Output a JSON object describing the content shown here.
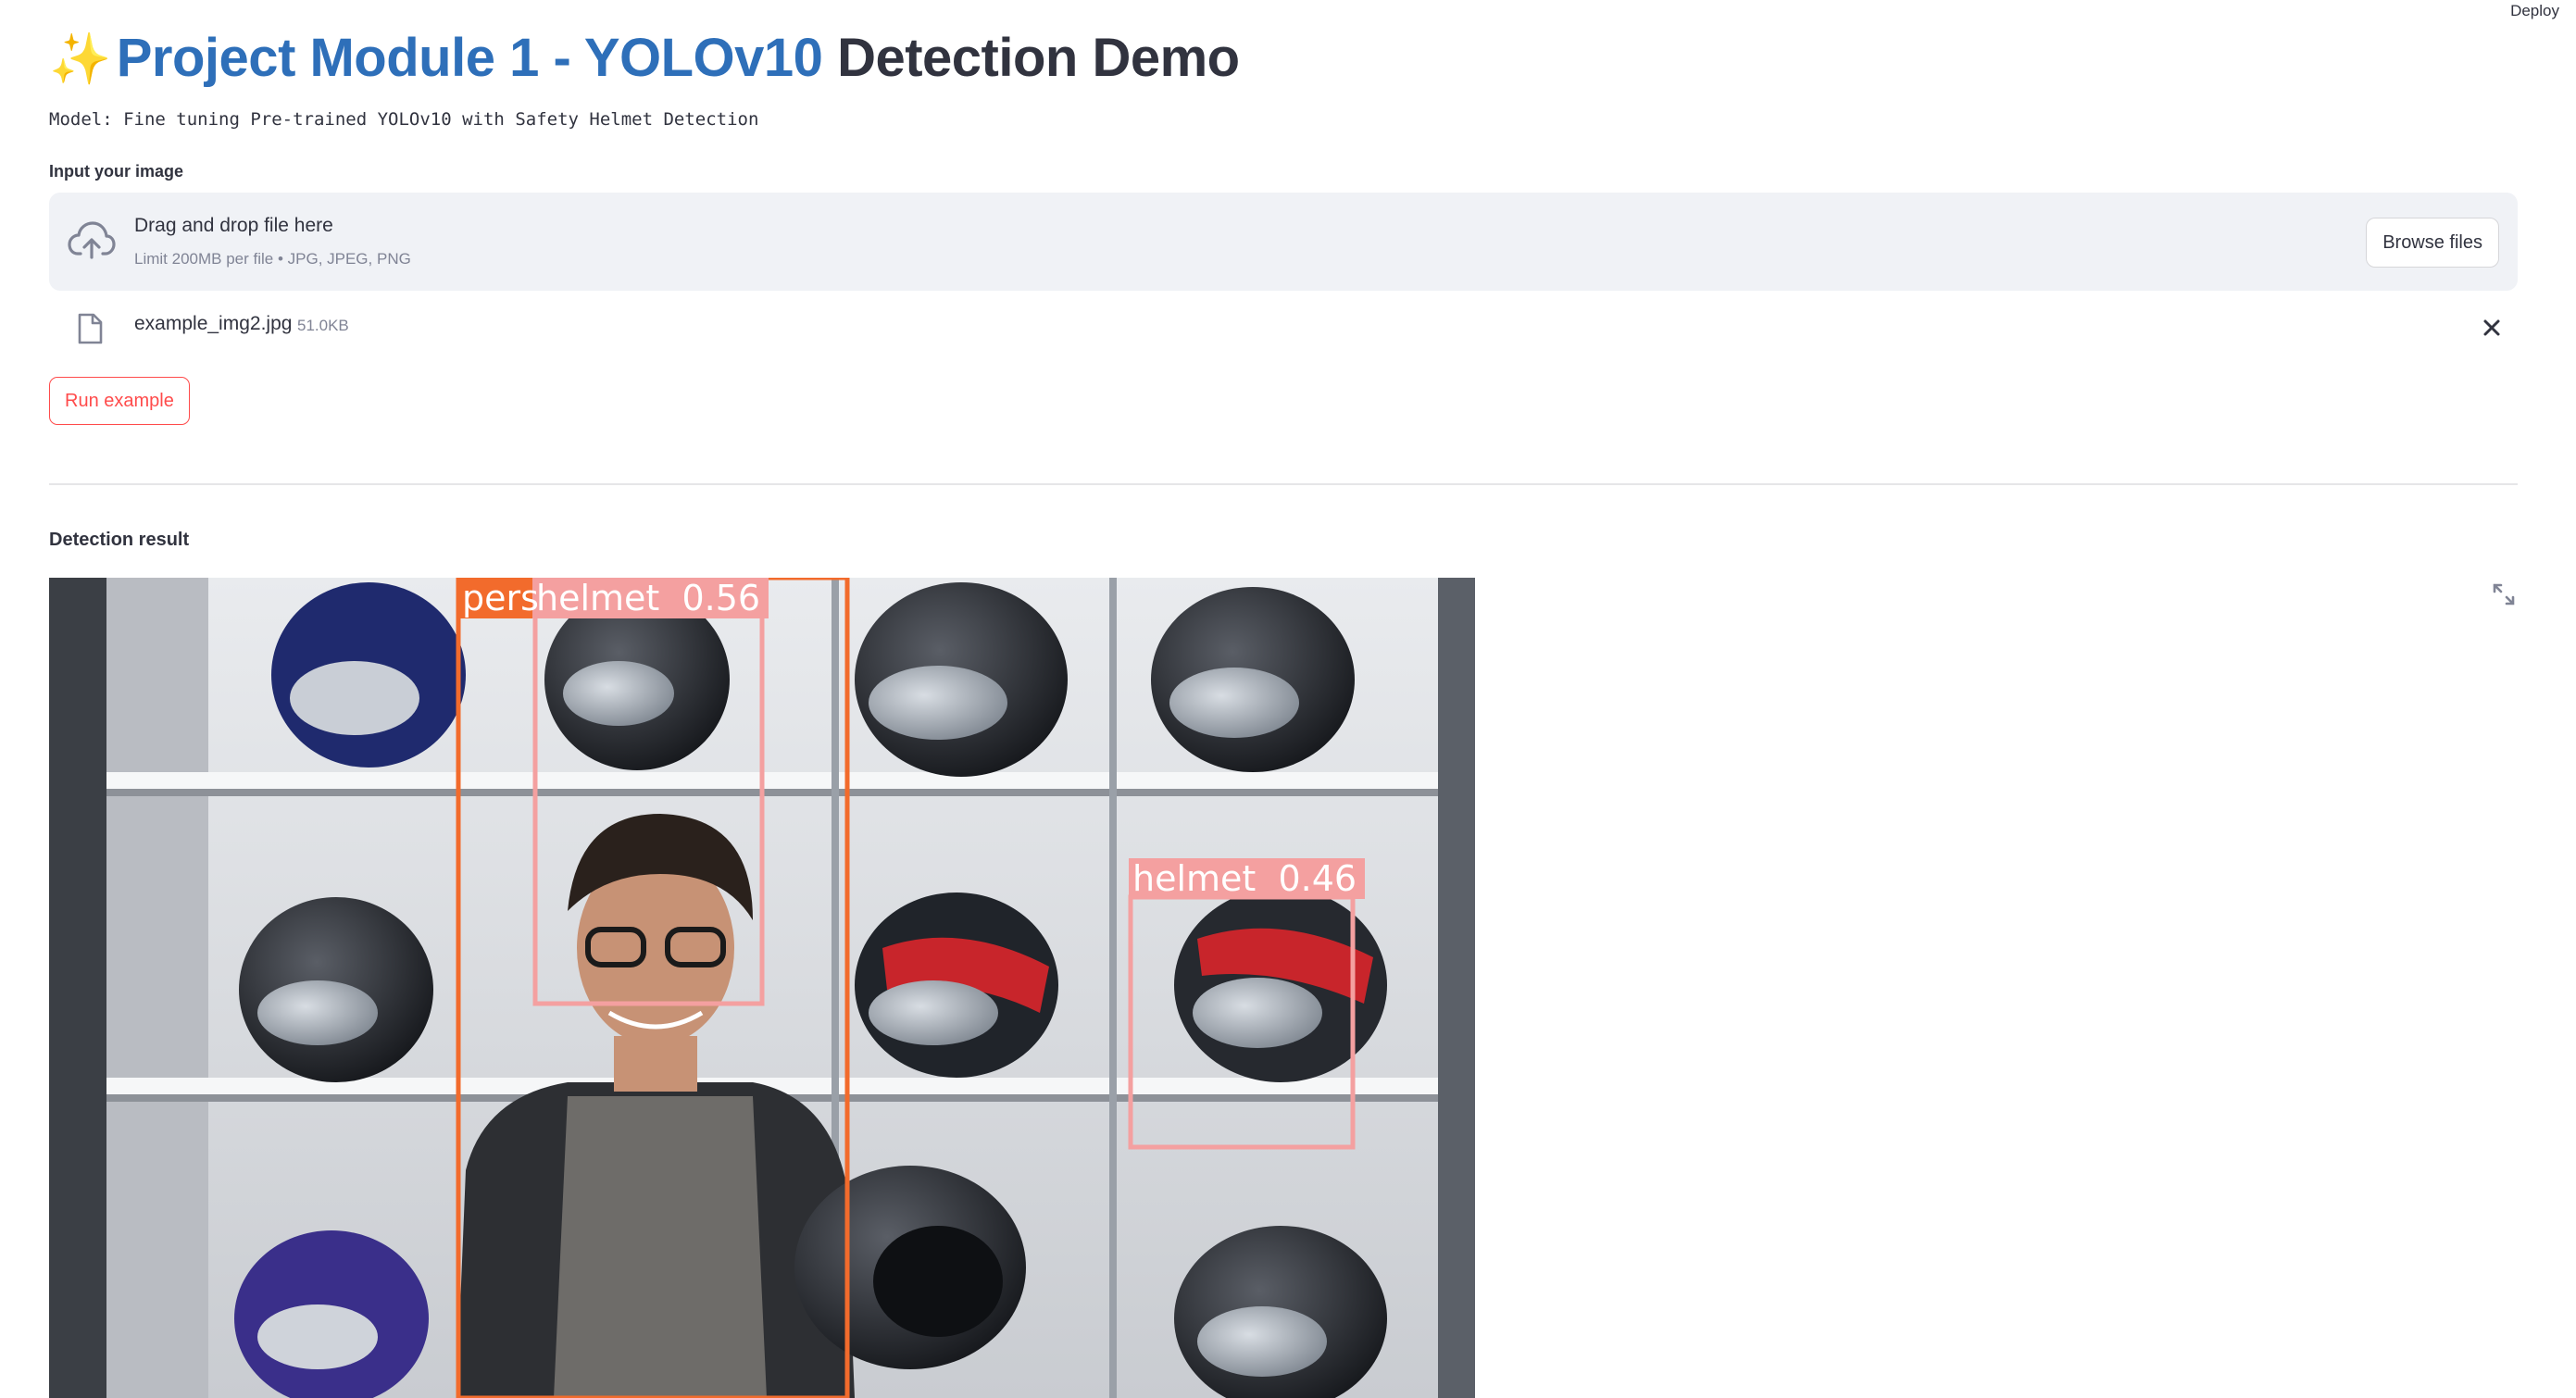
{
  "header": {
    "deploy_label": "Deploy"
  },
  "title": {
    "emoji": "✨",
    "blue_part": "Project Module 1 - YOLOv10",
    "dark_part": " Detection Demo"
  },
  "model_line": "Model: Fine tuning Pre-trained YOLOv10 with Safety Helmet Detection",
  "uploader": {
    "label": "Input your image",
    "drop_text": "Drag and drop file here",
    "limit_text": "Limit 200MB per file • JPG, JPEG, PNG",
    "browse_label": "Browse files",
    "file": {
      "name": "example_img2.jpg",
      "size": "51.0KB"
    }
  },
  "run_button_label": "Run example",
  "result": {
    "label": "Detection result",
    "detections": [
      {
        "label_text": "pers",
        "color": "#f26b2c"
      },
      {
        "label_text": "helmet  0.56",
        "color": "#f4a0a0"
      },
      {
        "label_text": "helmet  0.46",
        "color": "#f4a0a0"
      }
    ]
  },
  "colors": {
    "accent": "#ff4b4b",
    "title_blue": "#2e6fb9",
    "text": "#31333f",
    "muted": "#808495",
    "dropzone_bg": "#f0f2f6"
  }
}
